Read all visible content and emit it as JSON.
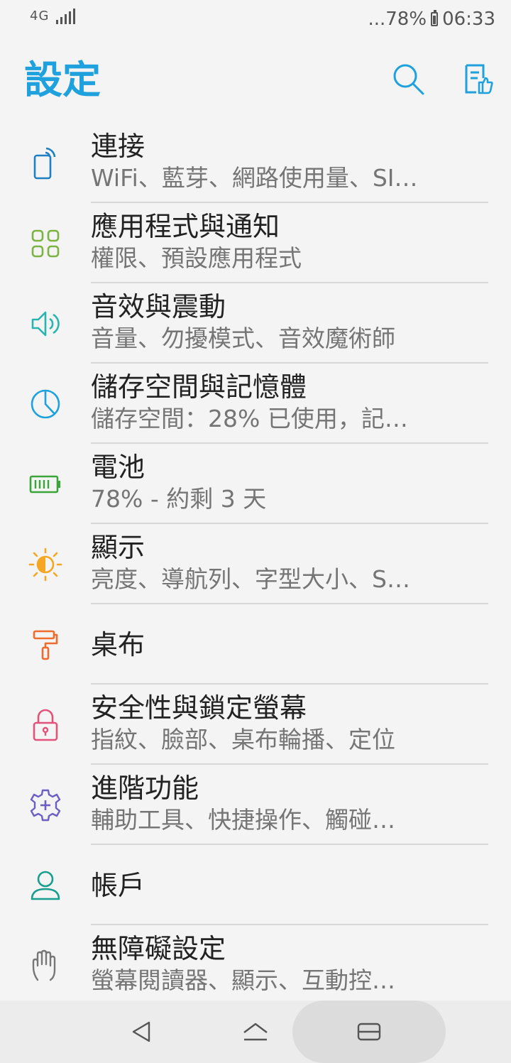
{
  "status_bar": {
    "network": "4G",
    "battery": "...78%",
    "time": "06:33"
  },
  "header": {
    "title": "設定"
  },
  "settings": {
    "items": [
      {
        "title": "連接",
        "subtitle": "WiFi、藍芽、網路使用量、SI…",
        "icon": "wireless-icon",
        "color": "#1e7fc2"
      },
      {
        "title": "應用程式與通知",
        "subtitle": "權限、預設應用程式",
        "icon": "apps-grid-icon",
        "color": "#7cb342"
      },
      {
        "title": "音效與震動",
        "subtitle": "音量、勿擾模式、音效魔術師",
        "icon": "speaker-icon",
        "color": "#26b5b0"
      },
      {
        "title": "儲存空間與記憶體",
        "subtitle": "儲存空間：28% 已使用，記…",
        "icon": "pie-chart-icon",
        "color": "#1ea1dc"
      },
      {
        "title": "電池",
        "subtitle": "78% - 約剩 3 天",
        "icon": "battery-icon",
        "color": "#3aa63a"
      },
      {
        "title": "顯示",
        "subtitle": "亮度、導航列、字型大小、S…",
        "icon": "brightness-icon",
        "color": "#f5a623"
      },
      {
        "title": "桌布",
        "subtitle": "",
        "icon": "paint-roller-icon",
        "color": "#ef6c2c"
      },
      {
        "title": "安全性與鎖定螢幕",
        "subtitle": "指紋、臉部、桌布輪播、定位",
        "icon": "lock-icon",
        "color": "#e2527a"
      },
      {
        "title": "進階功能",
        "subtitle": "輔助工具、快捷操作、觸碰…",
        "icon": "gear-plus-icon",
        "color": "#6b5fc4"
      },
      {
        "title": "帳戶",
        "subtitle": "",
        "icon": "person-icon",
        "color": "#179e8e"
      },
      {
        "title": "無障礙設定",
        "subtitle": "螢幕閱讀器、顯示、互動控…",
        "icon": "hand-icon",
        "color": "#777777"
      }
    ]
  },
  "colors": {
    "accent": "#1ea1dc",
    "background": "#f4f4f4"
  }
}
